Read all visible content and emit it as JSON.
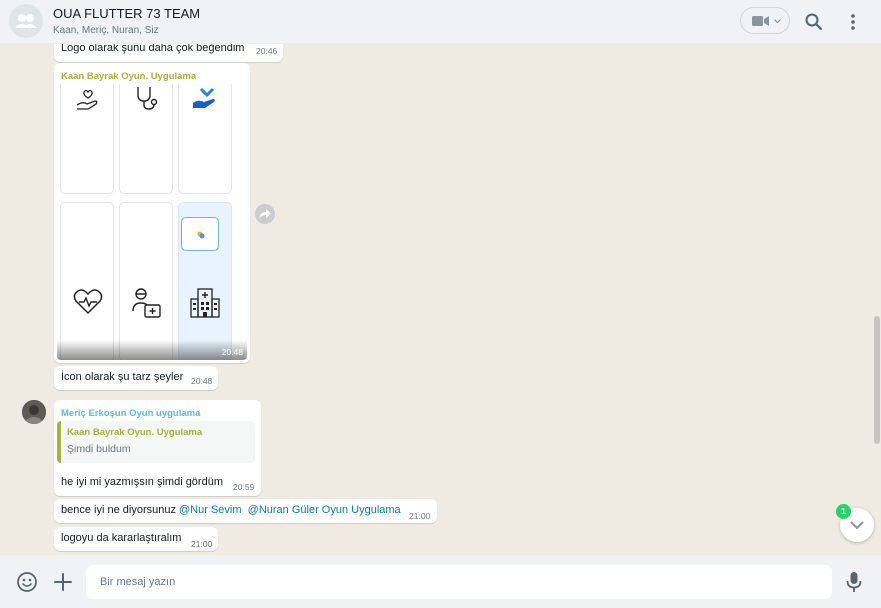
{
  "header": {
    "title": "OUA FLUTTER 73 TEAM",
    "members": "Kaan, Meriç, Nuran, Siz",
    "icons": {
      "avatar": "group-avatar-icon",
      "video": "video-call-icon",
      "search": "search-icon",
      "menu": "menu-dots-icon"
    }
  },
  "messages": [
    {
      "text": "Logo olarak şunu daha çok beğendim",
      "time": "20:46"
    },
    {
      "sender": "Kaan Bayrak Oyun. Uygulama",
      "sender_color": "#a5b337",
      "type": "image-grid",
      "time": "20:48",
      "icons": [
        "hand-heart-icon",
        "stethoscope-icon",
        "hand-medical-icon",
        "heart-pulse-icon",
        "doctor-kit-icon",
        "hospital-icon"
      ]
    },
    {
      "text": "İcon olarak şu tarz şeyler",
      "time": "20:48"
    },
    {
      "sender": "Meriç Erkoşun Oyun uygulama",
      "sender_color": "#53bdeb",
      "quote": {
        "sender": "Kaan Bayrak Oyun. Uygulama",
        "text": "Şimdi buldum"
      },
      "text": "he iyi mi yazmışsın şimdi gördüm",
      "time": "20:59"
    },
    {
      "text_prefix": "bence iyi ne diyorsunuz ",
      "mentions": [
        "@Nur Sevim",
        "@Nuran Güler Oyun Uygulama"
      ],
      "time": "21:00"
    },
    {
      "text": "logoyu da kararlaştıralım",
      "time": "21:00"
    }
  ],
  "unread_count": "1",
  "footer": {
    "placeholder": "Bir mesaj yazın",
    "icons": {
      "emoji": "emoji-icon",
      "attach": "plus-icon",
      "mic": "microphone-icon"
    }
  },
  "colors": {
    "header_bg": "#f0f2f5",
    "chat_bg": "#efeae2",
    "accent_green": "#25d366",
    "mention_blue": "#027eb5"
  }
}
